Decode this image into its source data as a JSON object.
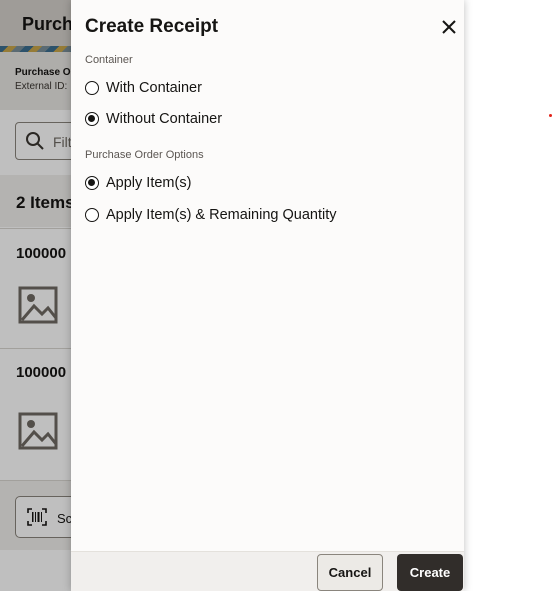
{
  "background": {
    "title": "Purcha",
    "info_line1": "Purchase O",
    "info_line2": "External ID:",
    "search_placeholder": "Filt",
    "items_count": "2 Items",
    "rows": [
      {
        "id": "100000"
      },
      {
        "id": "100000"
      }
    ],
    "scan_label": "Sc",
    "icons": {
      "search": "search-icon",
      "image": "image-placeholder-icon",
      "scan": "barcode-scan-icon"
    }
  },
  "dialog": {
    "title": "Create Receipt",
    "close_icon": "close-icon",
    "container": {
      "label": "Container",
      "options": [
        {
          "label": "With Container",
          "checked": false
        },
        {
          "label": "Without Container",
          "checked": true
        }
      ]
    },
    "po_options": {
      "label": "Purchase Order Options",
      "options": [
        {
          "label": "Apply Item(s)",
          "checked": true
        },
        {
          "label": "Apply Item(s) & Remaining Quantity",
          "checked": false
        }
      ]
    },
    "buttons": {
      "cancel": "Cancel",
      "create": "Create"
    }
  },
  "colors": {
    "primary_button": "#312d2a",
    "text": "#161513"
  }
}
